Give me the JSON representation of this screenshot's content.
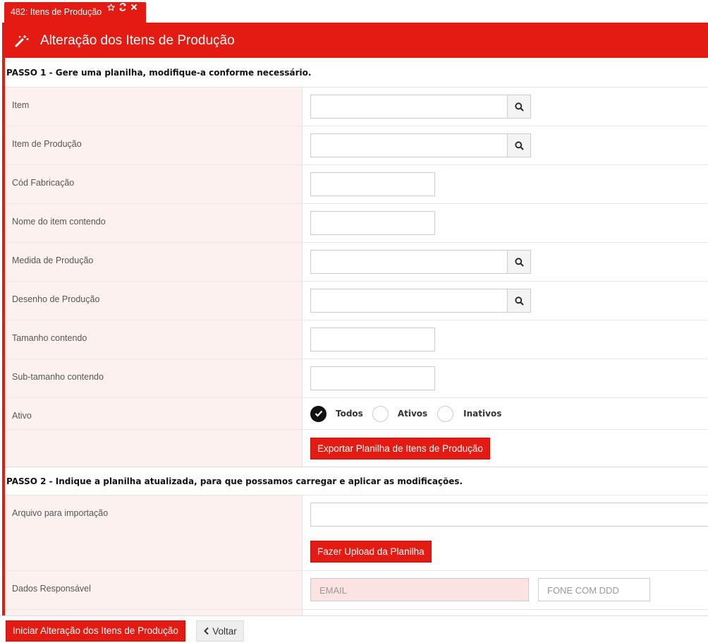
{
  "tab": {
    "title": "482: Itens de Produção"
  },
  "header": {
    "title": "Alteração dos Itens de Produção"
  },
  "step1": {
    "text": "PASSO 1 - Gere uma planilha, modifique-a conforme necessário."
  },
  "fields": {
    "item": "Item",
    "item_producao": "Item de Produção",
    "cod_fabricacao": "Cód Fabricação",
    "nome_item": "Nome do item contendo",
    "medida_producao": "Medida de Produção",
    "desenho_producao": "Desenho de Produção",
    "tamanho": "Tamanho contendo",
    "sub_tamanho": "Sub-tamanho contendo",
    "ativo": "Ativo"
  },
  "ativo_options": {
    "todos": "Todos",
    "ativos": "Ativos",
    "inativos": "Inativos",
    "selected": "Todos"
  },
  "export_button": "Exportar Planilha de Itens de Produção",
  "step2": {
    "text": "PASSO 2 - Indique a planilha atualizada, para que possamos carregar e aplicar as modificações."
  },
  "arquivo_label": "Arquivo para importação",
  "upload_button": "Fazer Upload da Planilha",
  "dados_label": "Dados Responsável",
  "email_placeholder": "EMAIL",
  "fone_placeholder": "FONE COM DDD",
  "footer": {
    "start_button": "Iniciar Alteração dos Itens de Produção",
    "back_button": "Voltar"
  },
  "colors": {
    "accent": "#e31b12",
    "label_bg": "#fdf1f0"
  }
}
